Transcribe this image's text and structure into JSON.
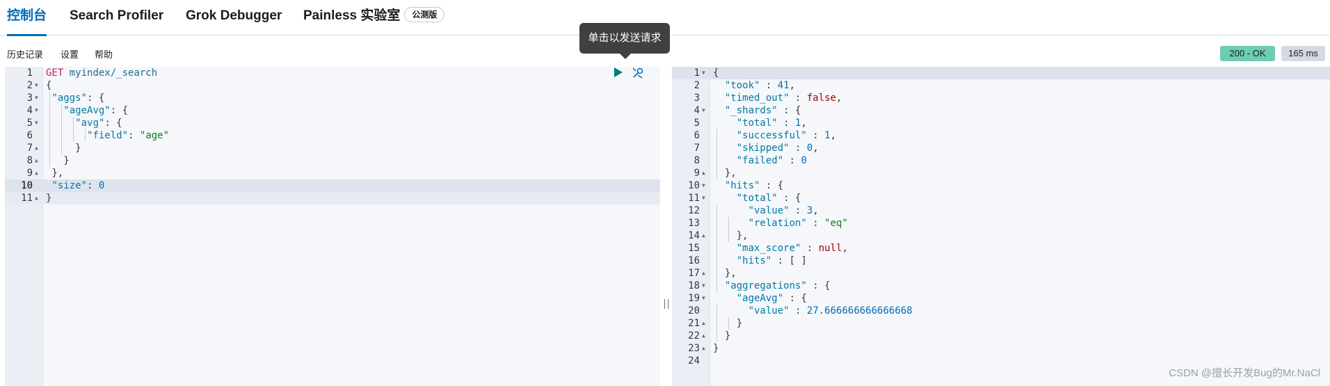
{
  "tabs": [
    {
      "label": "控制台",
      "active": true
    },
    {
      "label": "Search Profiler",
      "active": false
    },
    {
      "label": "Grok Debugger",
      "active": false
    },
    {
      "label": "Painless 实验室",
      "active": false,
      "badge": "公测版"
    }
  ],
  "menu": {
    "history": "历史记录",
    "settings": "设置",
    "help": "帮助"
  },
  "tooltip": "单击以发送请求",
  "status": {
    "code": "200 - OK",
    "time": "165 ms",
    "ok_color": "#6dccb1"
  },
  "request": {
    "line_numbers": [
      "1",
      "2",
      "3",
      "4",
      "5",
      "6",
      "7",
      "8",
      "9",
      "10",
      "11"
    ],
    "method": "GET",
    "path": "myindex/_search",
    "aggs_key": "\"aggs\"",
    "agg_name_key": "\"ageAvg\"",
    "avg_key": "\"avg\"",
    "field_key": "\"field\"",
    "field_value": "\"age\"",
    "size_key": "\"size\"",
    "size_value": "0"
  },
  "response": {
    "line_numbers": [
      "1",
      "2",
      "3",
      "4",
      "5",
      "6",
      "7",
      "8",
      "9",
      "10",
      "11",
      "12",
      "13",
      "14",
      "15",
      "16",
      "17",
      "18",
      "19",
      "20",
      "21",
      "22",
      "23",
      "24"
    ],
    "took_key": "\"took\"",
    "took": "41",
    "timed_out_key": "\"timed_out\"",
    "timed_out": "false",
    "shards_key": "\"_shards\"",
    "total_key": "\"total\"",
    "shards_total": "1",
    "successful_key": "\"successful\"",
    "successful": "1",
    "skipped_key": "\"skipped\"",
    "skipped": "0",
    "failed_key": "\"failed\"",
    "failed": "0",
    "hits_key": "\"hits\"",
    "value_key": "\"value\"",
    "hits_total_value": "3",
    "relation_key": "\"relation\"",
    "relation": "\"eq\"",
    "max_score_key": "\"max_score\"",
    "max_score": "null",
    "hits_array": "[ ]",
    "aggregations_key": "\"aggregations\"",
    "agg_name_key": "\"ageAvg\"",
    "avg_value": "27.666666666666668"
  },
  "watermark": "CSDN @擅长开发Bug的Mr.NaCl"
}
